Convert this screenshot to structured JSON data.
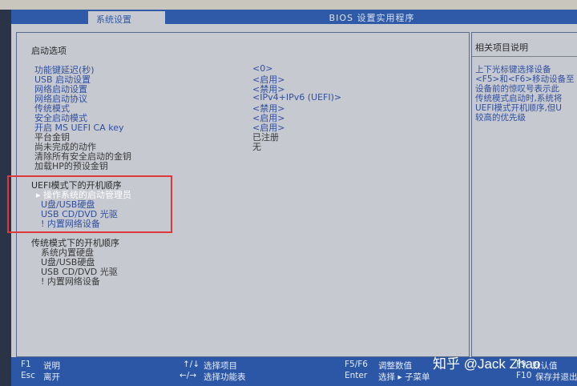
{
  "header": {
    "active_tab": "系统设置",
    "app_title": "BIOS 设置实用程序"
  },
  "main": {
    "section_title": "启动选项",
    "settings": [
      {
        "label": "功能键延迟(秒)",
        "value": "<0>"
      },
      {
        "label": "USB 启动设置",
        "value": "<启用>"
      },
      {
        "label": "网络启动设置",
        "value": "<禁用>"
      },
      {
        "label": "网络启动协议",
        "value": "<IPv4+IPv6 (UEFI)>"
      },
      {
        "label": "传统模式",
        "value": "<禁用>"
      },
      {
        "label": "安全启动模式",
        "value": "<启用>"
      },
      {
        "label": "开启 MS UEFI CA key",
        "value": "<启用>"
      },
      {
        "label": "平台金钥",
        "value": "已注册"
      },
      {
        "label": "尚未完成的动作",
        "value": "无"
      },
      {
        "label": "清除所有安全启动的金钥",
        "value": ""
      },
      {
        "label": "加载HP的预设金钥",
        "value": ""
      }
    ],
    "uefi_boot": {
      "title": "UEFI模式下的开机顺序",
      "items": [
        "▸ 操作系统的启动管理员",
        "U盘/USB硬盘",
        "USB CD/DVD 光驱",
        "! 内置网络设备"
      ]
    },
    "legacy_boot": {
      "title": "传统模式下的开机顺序",
      "items": [
        "系统内置硬盘",
        "U盘/USB硬盘",
        "USB CD/DVD 光驱",
        "! 内置网络设备"
      ]
    }
  },
  "help": {
    "title": "相关项目说明",
    "lines": [
      "上下光标键选择设备",
      "<F5>和<F6>移动设备至",
      "设备前的惊叹号表示此",
      "传统模式启动时,系统将",
      "UEFI模式开机顺序,但U",
      "较高的优先级"
    ]
  },
  "footer": {
    "items": [
      {
        "key": "F1",
        "desc": "说明"
      },
      {
        "key": "Esc",
        "desc": "离开"
      },
      {
        "key": "↑/↓",
        "desc": "选择项目"
      },
      {
        "key": "←/→",
        "desc": "选择功能表"
      },
      {
        "key": "F5/F6",
        "desc": "调整数值"
      },
      {
        "key": "Enter",
        "desc": "选择 ▸ 子菜单"
      },
      {
        "key": "F9",
        "desc": "默认值"
      },
      {
        "key": "F10",
        "desc": "保存并退出"
      }
    ]
  },
  "watermark": "知乎 @Jack Zhao",
  "colors": {
    "header_blue": "#2f5aa8",
    "screen_gray": "#c7c9d0",
    "text_blue": "#2f4fa0",
    "highlight_red": "#e0373c"
  }
}
